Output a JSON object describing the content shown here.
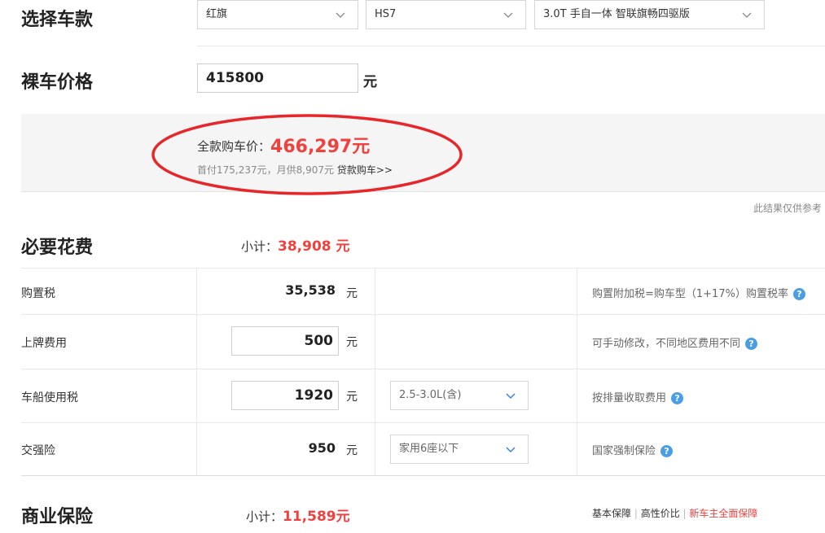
{
  "select_car": {
    "title": "选择车款",
    "brand": "红旗",
    "model": "HS7",
    "trim": "3.0T 手自一体 智联旗畅四驱版"
  },
  "bare_price": {
    "title": "裸车价格",
    "value": "415800",
    "unit": "元"
  },
  "summary": {
    "total_label": "全款购车价：",
    "total_value": "466,297元",
    "loan_info": "首付175,237元，月供8,907元",
    "loan_link": "贷款购车>>",
    "disclaimer": "此结果仅供参考"
  },
  "required": {
    "title": "必要花费",
    "subtotal_label": "小计：",
    "subtotal_value": "38,908 元",
    "rows": [
      {
        "label": "购置税",
        "value": "35,538",
        "unit": "元",
        "note": "购置附加税=购车型（1+17%）购置税率"
      },
      {
        "label": "上牌费用",
        "value": "500",
        "unit": "元",
        "note": "可手动修改，不同地区费用不同"
      },
      {
        "label": "车船使用税",
        "value": "1920",
        "unit": "元",
        "option": "2.5-3.0L(含)",
        "note": "按排量收取费用"
      },
      {
        "label": "交强险",
        "value": "950",
        "unit": "元",
        "option": "家用6座以下",
        "note": "国家强制保险"
      }
    ]
  },
  "commercial": {
    "title": "商业保险",
    "subtotal_label": "小计：",
    "subtotal_value": "11,589元",
    "links": [
      "基本保障",
      "高性价比",
      "新车主全面保障"
    ]
  },
  "colors": {
    "accent_red": "#f0413e",
    "help_blue": "#4a9ee6",
    "highlight_oval": "#e8262a"
  }
}
